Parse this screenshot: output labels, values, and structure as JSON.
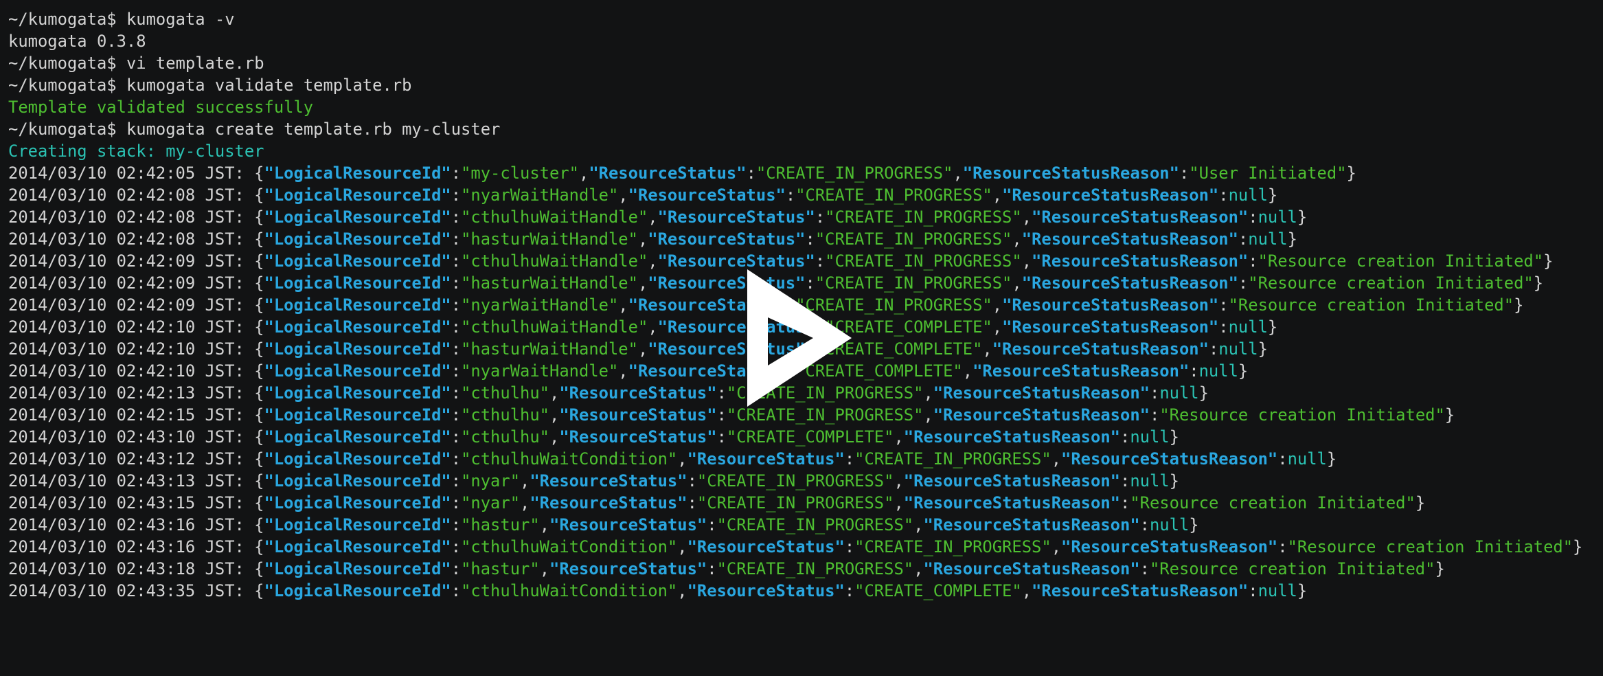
{
  "terminal": {
    "session": [
      {
        "prompt": "~/kumogata$",
        "command": "kumogata -v"
      },
      {
        "output": "kumogata 0.3.8"
      },
      {
        "prompt": "~/kumogata$",
        "command": "vi template.rb"
      },
      {
        "prompt": "~/kumogata$",
        "command": "kumogata validate template.rb"
      },
      {
        "output": "Template validated successfully",
        "style": "green"
      },
      {
        "prompt": "~/kumogata$",
        "command": "kumogata create template.rb my-cluster"
      },
      {
        "output": "Creating stack: my-cluster",
        "style": "cyan"
      }
    ],
    "key_labels": {
      "logical": "\"LogicalResourceId\"",
      "status": "\"ResourceStatus\"",
      "reason": "\"ResourceStatusReason\""
    },
    "events": [
      {
        "timestamp": "2014/03/10 02:42:05 JST:",
        "logical_id": "\"my-cluster\"",
        "status": "\"CREATE_IN_PROGRESS\"",
        "reason": "\"User Initiated\""
      },
      {
        "timestamp": "2014/03/10 02:42:08 JST:",
        "logical_id": "\"nyarWaitHandle\"",
        "status": "\"CREATE_IN_PROGRESS\"",
        "reason": "null"
      },
      {
        "timestamp": "2014/03/10 02:42:08 JST:",
        "logical_id": "\"cthulhuWaitHandle\"",
        "status": "\"CREATE_IN_PROGRESS\"",
        "reason": "null"
      },
      {
        "timestamp": "2014/03/10 02:42:08 JST:",
        "logical_id": "\"hasturWaitHandle\"",
        "status": "\"CREATE_IN_PROGRESS\"",
        "reason": "null"
      },
      {
        "timestamp": "2014/03/10 02:42:09 JST:",
        "logical_id": "\"cthulhuWaitHandle\"",
        "status": "\"CREATE_IN_PROGRESS\"",
        "reason": "\"Resource creation Initiated\""
      },
      {
        "timestamp": "2014/03/10 02:42:09 JST:",
        "logical_id": "\"hasturWaitHandle\"",
        "status": "\"CREATE_IN_PROGRESS\"",
        "reason": "\"Resource creation Initiated\""
      },
      {
        "timestamp": "2014/03/10 02:42:09 JST:",
        "logical_id": "\"nyarWaitHandle\"",
        "status": "\"CREATE_IN_PROGRESS\"",
        "reason": "\"Resource creation Initiated\""
      },
      {
        "timestamp": "2014/03/10 02:42:10 JST:",
        "logical_id": "\"cthulhuWaitHandle\"",
        "status": "\"CREATE_COMPLETE\"",
        "reason": "null"
      },
      {
        "timestamp": "2014/03/10 02:42:10 JST:",
        "logical_id": "\"hasturWaitHandle\"",
        "status": "\"CREATE_COMPLETE\"",
        "reason": "null"
      },
      {
        "timestamp": "2014/03/10 02:42:10 JST:",
        "logical_id": "\"nyarWaitHandle\"",
        "status": "\"CREATE_COMPLETE\"",
        "reason": "null"
      },
      {
        "timestamp": "2014/03/10 02:42:13 JST:",
        "logical_id": "\"cthulhu\"",
        "status": "\"CREATE_IN_PROGRESS\"",
        "reason": "null"
      },
      {
        "timestamp": "2014/03/10 02:42:15 JST:",
        "logical_id": "\"cthulhu\"",
        "status": "\"CREATE_IN_PROGRESS\"",
        "reason": "\"Resource creation Initiated\""
      },
      {
        "timestamp": "2014/03/10 02:43:10 JST:",
        "logical_id": "\"cthulhu\"",
        "status": "\"CREATE_COMPLETE\"",
        "reason": "null"
      },
      {
        "timestamp": "2014/03/10 02:43:12 JST:",
        "logical_id": "\"cthulhuWaitCondition\"",
        "status": "\"CREATE_IN_PROGRESS\"",
        "reason": "null"
      },
      {
        "timestamp": "2014/03/10 02:43:13 JST:",
        "logical_id": "\"nyar\"",
        "status": "\"CREATE_IN_PROGRESS\"",
        "reason": "null"
      },
      {
        "timestamp": "2014/03/10 02:43:15 JST:",
        "logical_id": "\"nyar\"",
        "status": "\"CREATE_IN_PROGRESS\"",
        "reason": "\"Resource creation Initiated\""
      },
      {
        "timestamp": "2014/03/10 02:43:16 JST:",
        "logical_id": "\"hastur\"",
        "status": "\"CREATE_IN_PROGRESS\"",
        "reason": "null"
      },
      {
        "timestamp": "2014/03/10 02:43:16 JST:",
        "logical_id": "\"cthulhuWaitCondition\"",
        "status": "\"CREATE_IN_PROGRESS\"",
        "reason": "\"Resource creation Initiated\""
      },
      {
        "timestamp": "2014/03/10 02:43:18 JST:",
        "logical_id": "\"hastur\"",
        "status": "\"CREATE_IN_PROGRESS\"",
        "reason": "\"Resource creation Initiated\""
      },
      {
        "timestamp": "2014/03/10 02:43:35 JST:",
        "logical_id": "\"cthulhuWaitCondition\"",
        "status": "\"CREATE_COMPLETE\"",
        "reason": "null"
      }
    ]
  },
  "player": {
    "icon": "play-icon",
    "colors": {
      "background": "#121314",
      "key": "#2aa7e0",
      "string": "#4ebf31",
      "cyan": "#2bc3b4",
      "text": "#d4d4d4",
      "play": "#ffffff"
    }
  }
}
